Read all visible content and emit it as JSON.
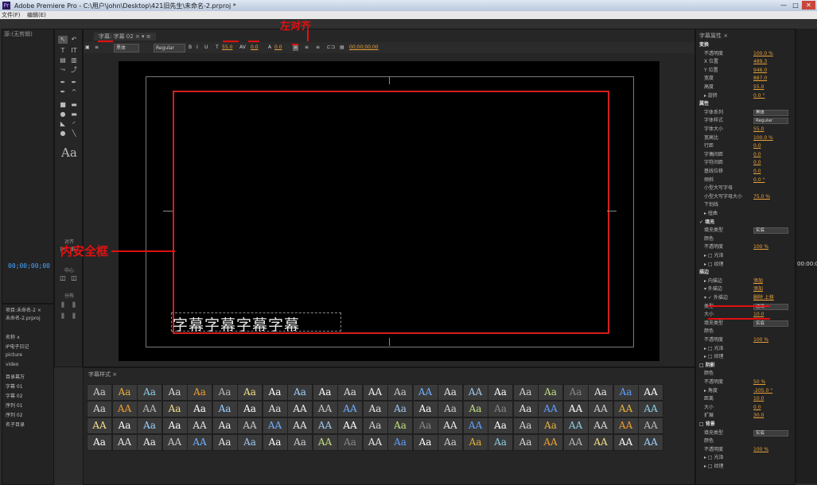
{
  "window": {
    "title": "Adobe Premiere Pro - C:\\用户\\john\\Desktop\\421旧先生\\未命名-2.prproj *",
    "app_icon_label": "Pr",
    "buttons": {
      "minimize": "—",
      "maximize": "□",
      "close": "✕"
    }
  },
  "menubar": {
    "items": [
      "文件(F)",
      "编辑(E)"
    ]
  },
  "left_panel": {
    "tab": "源:(无剪辑)",
    "timecode": "00;00;00;00"
  },
  "tools": {
    "sample_label": "Aa",
    "section_labels": [
      "对齐",
      "中心",
      "分布"
    ],
    "icons": [
      "selection-icon",
      "rotate-icon",
      "type-tool-icon",
      "vertical-type-icon",
      "area-type-icon",
      "vertical-area-type-icon",
      "path-type-icon",
      "vertical-path-type-icon",
      "pen-icon",
      "delete-anchor-icon",
      "add-anchor-icon",
      "convert-anchor-icon",
      "rectangle-icon",
      "rounded-rectangle-icon",
      "clipped-rectangle-icon",
      "rounded-corner-icon",
      "wedge-icon",
      "arc-icon",
      "ellipse-icon",
      "line-icon"
    ]
  },
  "project_panel": {
    "tab": "项目:未命名-2 ×",
    "file": "未命名-2.prproj",
    "header": "名称 ∧",
    "items": [
      "IP电子日记",
      "picture",
      "video",
      "目录幕万",
      "字幕 01",
      "字幕 02",
      "序列 01",
      "序列 02",
      "名子目录"
    ]
  },
  "title_panel": {
    "tab": "字幕: 字幕 02 × ▾ ≡",
    "toolbar": {
      "font_family": "黑体",
      "font_style": "Regular",
      "font_size": "55.0",
      "kerning": "0.0",
      "leading": "0.0",
      "tracking": "0.0",
      "timecode": "00;00;00;00"
    },
    "subtitle_text": "字幕字幕字幕字幕"
  },
  "styles_panel": {
    "tab": "字幕样式 ×",
    "rows": [
      [
        "Aa",
        "Aa",
        "Aa",
        "Aa",
        "Aa",
        "Aa",
        "Aa",
        "Aa",
        "Aa",
        "Aa",
        "Aa",
        "AA",
        "Aa",
        "AA",
        "Aa",
        "AA",
        "Aa",
        "Aa",
        "Aa",
        "Aa",
        "Aa",
        "Aa",
        "AA"
      ],
      [
        "Aa",
        "AA",
        "AA",
        "Aa",
        "Aa",
        "Aa",
        "Aa",
        "Aa",
        "AA",
        "AA",
        "AA",
        "Aa",
        "Aa",
        "Aa",
        "Aa",
        "Aa",
        "Aa",
        "Aa",
        "AA",
        "AA",
        "AA",
        "AA",
        "AA"
      ],
      [
        "AA",
        "Aa",
        "Aa",
        "Aa",
        "AA",
        "Aa",
        "AA",
        "AA",
        "AA",
        "AA",
        "AA",
        "Aa",
        "Aa",
        "Aa",
        "AA",
        "AA",
        "Aa",
        "Aa",
        "Aa",
        "AA",
        "AA",
        "AA",
        "AA"
      ],
      [
        "Aa",
        "AA",
        "Aa",
        "AA",
        "AA",
        "Aa",
        "Aa",
        "Aa",
        "Aa",
        "AA",
        "Aa",
        "AA",
        "Aa",
        "Aa",
        "Aa",
        "Aa",
        "Aa",
        "Aa",
        "AA",
        "AA",
        "AA",
        "AA",
        "AA"
      ]
    ],
    "colors": [
      "#cfcfcf",
      "#e8b33a",
      "#8ecfe8",
      "#d8d8d8",
      "#f0a030",
      "#b8b8b8",
      "#f5e08a",
      "#ffffff",
      "#9fd0ff",
      "#ffffff",
      "#e0e0e0",
      "#f0f0f0",
      "#c8c8c8",
      "#70b0ff",
      "#e6e6e6",
      "#a0c8f0",
      "#ffffff",
      "#d0d0d0",
      "#c0e080",
      "#888888",
      "#e8e8e8",
      "#60a0ff",
      "#ffffff"
    ]
  },
  "properties": {
    "tab": "字幕属性 ×",
    "rows": [
      {
        "label": "变换",
        "heading": true
      },
      {
        "label": "不透明度",
        "value": "100.0 %"
      },
      {
        "label": "X 位置",
        "value": "489.3"
      },
      {
        "label": "Y 位置",
        "value": "946.0"
      },
      {
        "label": "宽度",
        "value": "887.0"
      },
      {
        "label": "高度",
        "value": "55.0"
      },
      {
        "label": "▸ 旋转",
        "value": "0.0 °"
      },
      {
        "label": "属性",
        "heading": true
      },
      {
        "label": "字体系列",
        "value": "黑体",
        "box": true
      },
      {
        "label": "字体样式",
        "value": "Regular",
        "box": true
      },
      {
        "label": "字体大小",
        "value": "55.0"
      },
      {
        "label": "宽高比",
        "value": "100.0 %"
      },
      {
        "label": "行距",
        "value": "0.0"
      },
      {
        "label": "字偶间距",
        "value": "0.0"
      },
      {
        "label": "字符间距",
        "value": "0.0"
      },
      {
        "label": "基线位移",
        "value": "0.0"
      },
      {
        "label": "倾斜",
        "value": "0.0 °"
      },
      {
        "label": "小型大写字母",
        "value": ""
      },
      {
        "label": "小型大写字母大小",
        "value": "75.0 %"
      },
      {
        "label": "下划线",
        "value": ""
      },
      {
        "label": "▸ 扭曲",
        "value": ""
      },
      {
        "label": "✓ 填充",
        "heading": true
      },
      {
        "label": "填充类型",
        "value": "实底",
        "box": true
      },
      {
        "label": "颜色",
        "value": ""
      },
      {
        "label": "不透明度",
        "value": "100 %"
      },
      {
        "label": "▸ □ 光泽",
        "value": ""
      },
      {
        "label": "▸ □ 纹理",
        "value": ""
      },
      {
        "label": "描边",
        "heading": true
      },
      {
        "label": "▸ 内描边",
        "value": "添加"
      },
      {
        "label": "▾ 外描边",
        "value": "添加"
      },
      {
        "label": "▾ ✓ 外描边",
        "value": "删除 上移"
      },
      {
        "label": "类型",
        "value": "边缘",
        "box": true
      },
      {
        "label": "大小",
        "value": "10.0"
      },
      {
        "label": "填充类型",
        "value": "实底",
        "box": true
      },
      {
        "label": "颜色",
        "value": ""
      },
      {
        "label": "不透明度",
        "value": "100 %"
      },
      {
        "label": "▸ □ 光泽",
        "value": ""
      },
      {
        "label": "▸ □ 纹理",
        "value": ""
      },
      {
        "label": "□ 阴影",
        "heading": true
      },
      {
        "label": "颜色",
        "value": ""
      },
      {
        "label": "不透明度",
        "value": "50 %"
      },
      {
        "label": "▸ 角度",
        "value": "-205.0 °"
      },
      {
        "label": "距离",
        "value": "10.0"
      },
      {
        "label": "大小",
        "value": "0.0"
      },
      {
        "label": "扩展",
        "value": "30.0"
      },
      {
        "label": "□ 背景",
        "heading": true
      },
      {
        "label": "填充类型",
        "value": "实底",
        "box": true
      },
      {
        "label": "颜色",
        "value": ""
      },
      {
        "label": "不透明度",
        "value": "100 %"
      },
      {
        "label": "▸ □ 光泽",
        "value": ""
      },
      {
        "label": "▸ □ 纹理",
        "value": ""
      }
    ]
  },
  "right_strip": {
    "timecode": "00:00:0"
  },
  "annotations": {
    "align_left": "左对齐",
    "safe_frame": "内安全框"
  },
  "colors": {
    "annotation_red": "#e21010",
    "accent_orange": "#e8a13a",
    "timecode_blue": "#4aa3ff"
  }
}
